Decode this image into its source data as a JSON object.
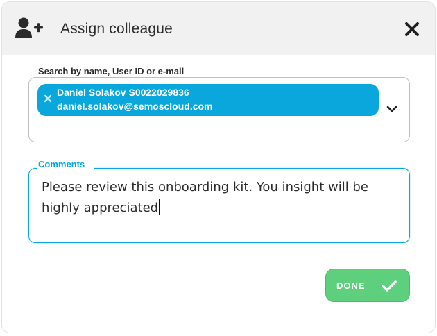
{
  "dialog": {
    "title": "Assign colleague",
    "header_icon": "add-user-icon",
    "close_icon": "close-icon"
  },
  "search": {
    "label": "Search by name, User ID or e-mail",
    "selected": [
      {
        "name_id": "Daniel Solakov S0022029836",
        "email": "daniel.solakov@semoscloud.com",
        "remove_icon": "remove-chip-icon"
      }
    ],
    "dropdown_icon": "chevron-down-icon"
  },
  "comments": {
    "label": "Comments",
    "value": "Please review this onboarding kit. You insight will be highly appreciated"
  },
  "actions": {
    "done_label": "DONE",
    "done_icon": "checkmark-icon"
  },
  "colors": {
    "accent": "#0aa7dc",
    "success": "#5ecf7d",
    "header_bg": "#f1f1f1",
    "text": "#2b2b2b"
  }
}
